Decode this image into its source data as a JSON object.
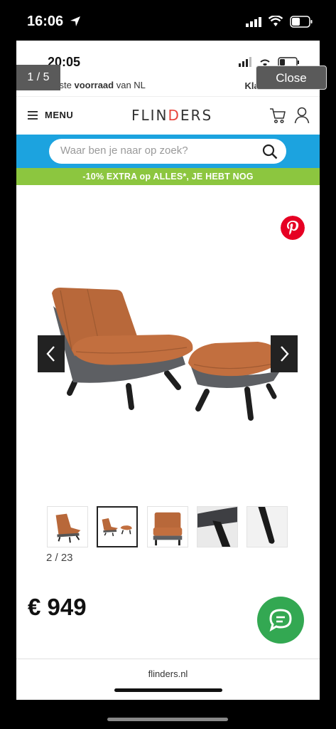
{
  "outer_status": {
    "time": "16:06"
  },
  "inner_status": {
    "time": "20:05"
  },
  "viewer": {
    "counter": "1 / 5",
    "close_label": "Close"
  },
  "usp": {
    "prefix": "Grootste ",
    "bold": "voorraad",
    "suffix": " van NL"
  },
  "service_link": "Klantenservice",
  "header": {
    "menu_label": "MENU",
    "logo": "FLINDERS"
  },
  "search": {
    "placeholder": "Waar ben je naar op zoek?"
  },
  "promo": "-10% EXTRA op ALLES*, JE HEBT NOG",
  "gallery": {
    "counter": "2 / 23",
    "active_index": 1,
    "thumbnail_count": 5
  },
  "product": {
    "price": "€ 949"
  },
  "footer": {
    "domain": "flinders.nl"
  },
  "colors": {
    "search_band": "#1ca3df",
    "promo": "#8cc63f",
    "chat": "#33a852",
    "pinterest": "#e60023",
    "leather": "#b8683a"
  },
  "icons": [
    "location-arrow-icon",
    "signal-icon",
    "wifi-icon",
    "battery-icon",
    "check-icon",
    "menu-icon",
    "cart-icon",
    "user-icon",
    "search-icon",
    "pinterest-icon",
    "chevron-left-icon",
    "chevron-right-icon",
    "chat-icon"
  ]
}
